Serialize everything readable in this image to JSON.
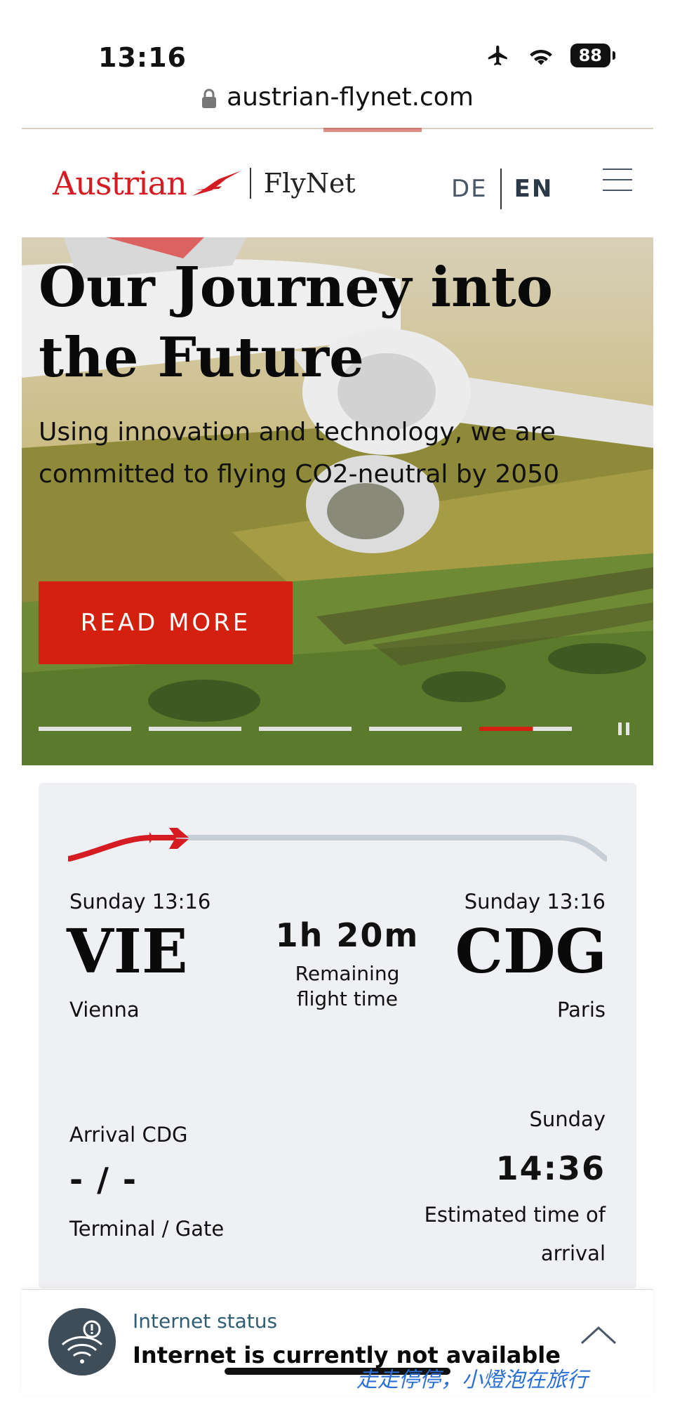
{
  "status_bar": {
    "time": "13:16",
    "battery": "88"
  },
  "url_bar": {
    "url": "austrian-flynet.com"
  },
  "header": {
    "brand": "Austrian",
    "product": "FlyNet",
    "languages": [
      "DE",
      "EN"
    ],
    "active_language": "EN"
  },
  "hero": {
    "title": "Our Journey into the Future",
    "subtitle": "Using innovation and technology, we are committed to flying CO2-neutral by 2050",
    "button_label": "READ MORE",
    "slides_total": 5,
    "active_slide": 5,
    "active_slide_progress": 0.58
  },
  "flight": {
    "origin": {
      "day_time": "Sunday 13:16",
      "code": "VIE",
      "city": "Vienna"
    },
    "destination": {
      "day_time": "Sunday 13:16",
      "code": "CDG",
      "city": "Paris"
    },
    "remaining_time": "1h 20m",
    "remaining_label_line1": "Remaining",
    "remaining_label_line2": "flight time",
    "progress_fraction": 0.21,
    "arrival_label": "Arrival CDG",
    "terminal_gate_value": "- / -",
    "terminal_gate_label": "Terminal / Gate",
    "eta_day": "Sunday",
    "eta_time": "14:36",
    "eta_label_line1": "Estimated time of",
    "eta_label_line2": "arrival"
  },
  "internet_status": {
    "label": "Internet status",
    "message": "Internet is currently not available"
  },
  "watermark": "走走停停，小燈泡在旅行",
  "colors": {
    "brand_red": "#d51c23",
    "button_red": "#d3200f",
    "card_bg": "#eff0f3",
    "track_gray": "#c7ced6"
  },
  "icons": [
    "airplane-mode-icon",
    "wifi-icon",
    "lock-icon",
    "logo-arrow-icon",
    "menu-icon",
    "pause-icon",
    "plane-icon",
    "wifi-warning-icon",
    "chevron-up-icon"
  ]
}
